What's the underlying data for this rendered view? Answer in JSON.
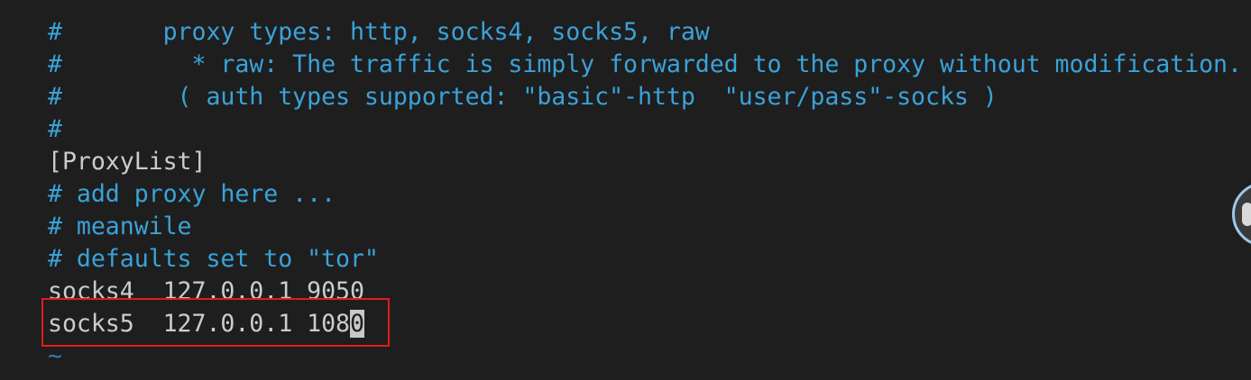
{
  "editor": {
    "lines": [
      "#       proxy types: http, socks4, socks5, raw",
      "#         * raw: The traffic is simply forwarded to the proxy without modification.",
      "#        ( auth types supported: \"basic\"-http  \"user/pass\"-socks )",
      "#",
      "[ProxyList]",
      "# add proxy here ...",
      "# meanwile",
      "# defaults set to \"tor\"",
      "socks4  127.0.0.1 9050"
    ],
    "cursor_line_before": "socks5  127.0.0.1 108",
    "cursor_char": "0",
    "tilde": "~"
  },
  "colors": {
    "background": "#1e1e1e",
    "comment": "#3aa2d9",
    "text": "#cccccc",
    "highlight_border": "#e31b1b"
  }
}
